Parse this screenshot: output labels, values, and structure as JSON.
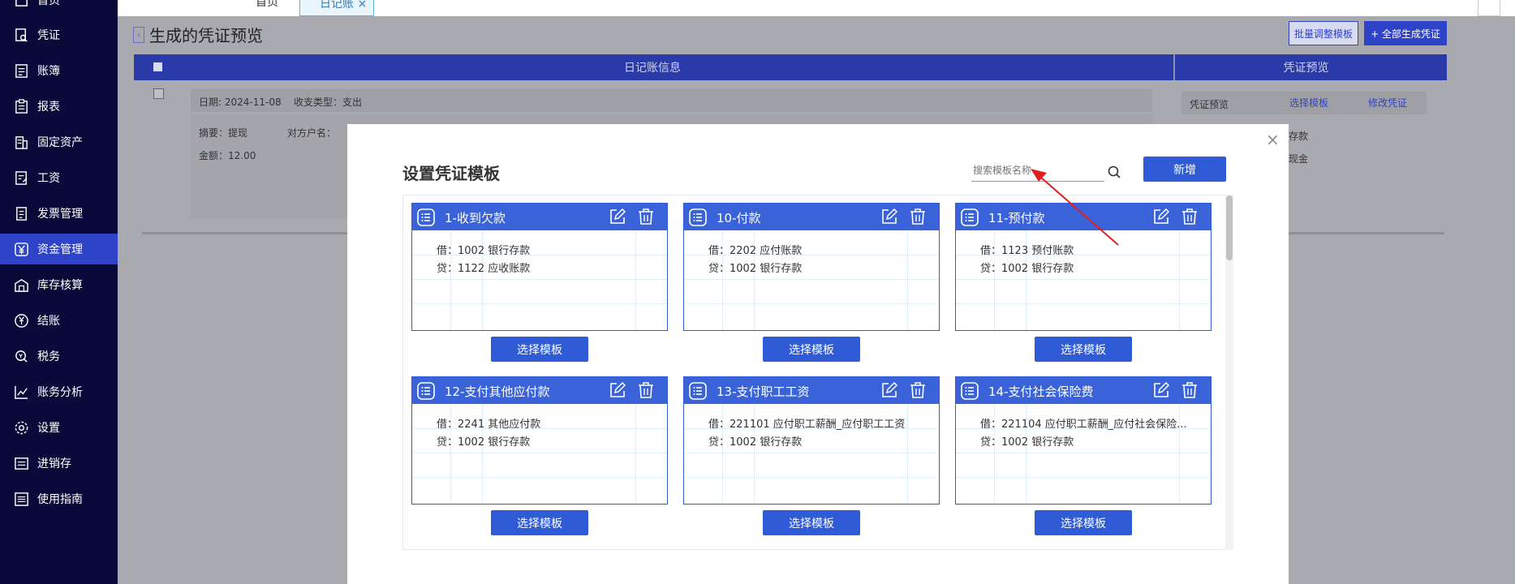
{
  "sidebar": {
    "items": [
      {
        "label": "首页",
        "icon": "home-icon"
      },
      {
        "label": "凭证",
        "icon": "voucher-icon"
      },
      {
        "label": "账簿",
        "icon": "ledger-icon"
      },
      {
        "label": "报表",
        "icon": "report-icon"
      },
      {
        "label": "固定资产",
        "icon": "building-icon"
      },
      {
        "label": "工资",
        "icon": "payroll-icon"
      },
      {
        "label": "发票管理",
        "icon": "invoice-icon"
      },
      {
        "label": "资金管理",
        "icon": "yen-icon",
        "active": true
      },
      {
        "label": "库存核算",
        "icon": "warehouse-icon"
      },
      {
        "label": "结账",
        "icon": "settle-icon"
      },
      {
        "label": "税务",
        "icon": "tax-icon"
      },
      {
        "label": "账务分析",
        "icon": "chart-icon"
      },
      {
        "label": "设置",
        "icon": "gear-icon"
      },
      {
        "label": "进销存",
        "icon": "inventory-icon"
      },
      {
        "label": "使用指南",
        "icon": "guide-icon"
      }
    ]
  },
  "tabs": {
    "home": "首页",
    "journal": "日记账 ×"
  },
  "page": {
    "title": "生成的凭证预览",
    "batch_button": "批量调整模板",
    "all_button": "+ 全部生成凭证",
    "journal_header": "日记账信息",
    "voucher_header": "凭证预览",
    "row": {
      "date": "日期: 2024-11-08",
      "type": "收支类型：支出",
      "summary": "摘要：提现",
      "party": "对方户名：",
      "amount": "金额：12.00"
    },
    "voucher_preview": {
      "label": "凭证预览",
      "select": "选择模板",
      "modify": "修改凭证",
      "line1": "存款",
      "line2": "现金"
    }
  },
  "modal": {
    "title": "设置凭证模板",
    "search_placeholder": "搜索模板名称",
    "add_button": "新增",
    "close": "×",
    "cards": [
      {
        "title": "1-收到欠款",
        "debit": "借：1002 银行存款",
        "credit": "贷：1122 应收账款",
        "button": "选择模板"
      },
      {
        "title": "10-付款",
        "debit": "借：2202 应付账款",
        "credit": "贷：1002 银行存款",
        "button": "选择模板"
      },
      {
        "title": "11-预付款",
        "debit": "借：1123 预付账款",
        "credit": "贷：1002 银行存款",
        "button": "选择模板"
      },
      {
        "title": "12-支付其他应付款",
        "debit": "借：2241 其他应付款",
        "credit": "贷：1002 银行存款",
        "button": "选择模板"
      },
      {
        "title": "13-支付职工工资",
        "debit": "借：221101 应付职工薪酬_应付职工工资",
        "credit": "贷：1002 银行存款",
        "button": "选择模板"
      },
      {
        "title": "14-支付社会保险费",
        "debit": "借：221104 应付职工薪酬_应付社会保险...",
        "credit": "贷：1002 银行存款",
        "button": "选择模板"
      }
    ]
  },
  "colors": {
    "sidebar_bg": "#0a0a3a",
    "accent": "#2f5bd6",
    "arrow": "#e02020"
  }
}
